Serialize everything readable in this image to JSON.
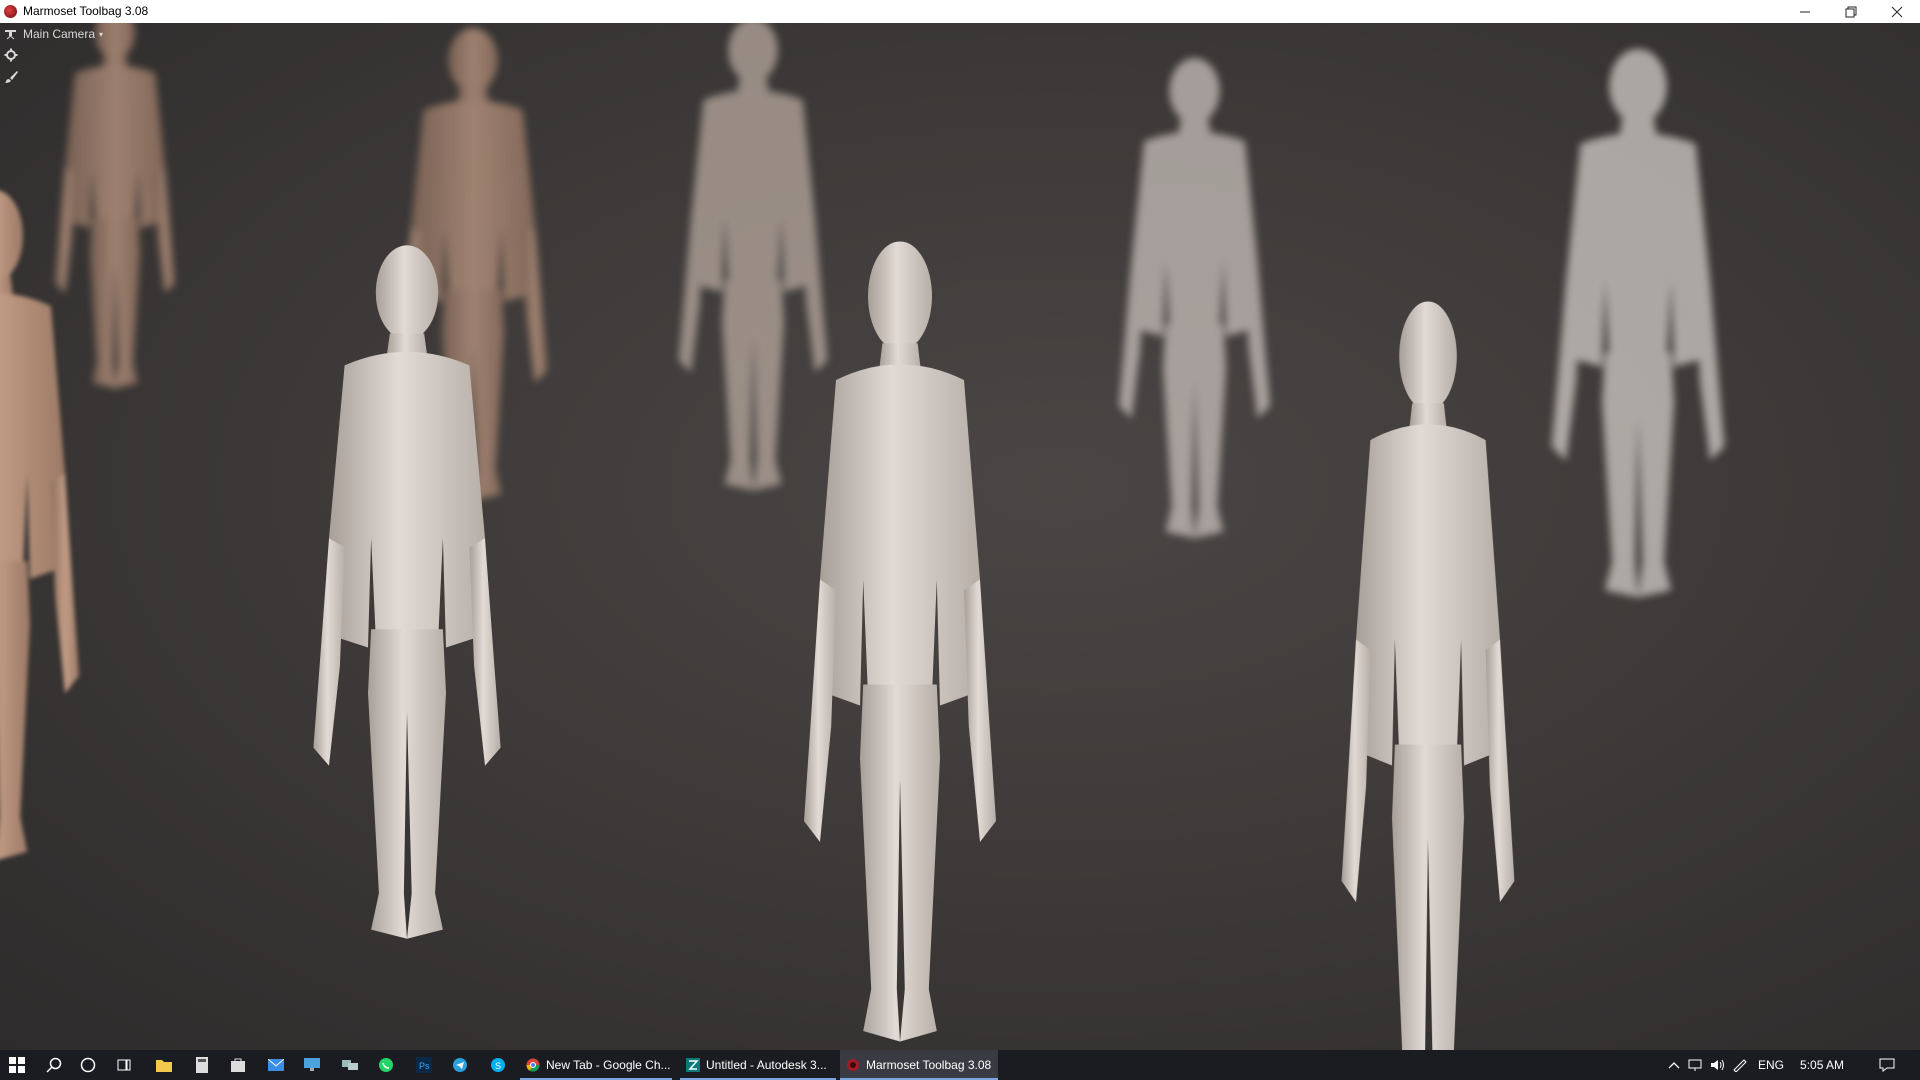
{
  "window": {
    "title": "Marmoset Toolbag 3.08",
    "controls": {
      "minimize": "—",
      "maximize": "❐",
      "close": "✕"
    }
  },
  "viewport": {
    "camera_menu": {
      "label": "Main Camera",
      "caret": "▾"
    },
    "tools": [
      "gear-icon",
      "brush-icon"
    ],
    "background_color": "#3d3a39",
    "figure_color": "#d8cfc8"
  },
  "taskbar": {
    "pinned_icons": [
      "windows-start-icon",
      "search-icon",
      "cortana-icon",
      "task-view-icon",
      "file-explorer-icon",
      "calculator-icon",
      "store-icon",
      "mail-icon",
      "remote-desktop-icon",
      "network-icon",
      "whatsapp-icon",
      "photoshop-icon",
      "telegram-icon",
      "skype-icon"
    ],
    "tasks": [
      {
        "label": "New Tab - Google Ch...",
        "icon": "chrome-icon",
        "active": false
      },
      {
        "label": "Untitled - Autodesk 3...",
        "icon": "3dsmax-icon",
        "active": false
      },
      {
        "label": "Marmoset Toolbag 3.08",
        "icon": "marmoset-icon",
        "active": true
      }
    ],
    "tray": {
      "icons": [
        "chevron-up-icon",
        "network-tray-icon",
        "volume-icon",
        "pen-icon"
      ],
      "language": "ENG",
      "time": "5:05 AM"
    }
  }
}
